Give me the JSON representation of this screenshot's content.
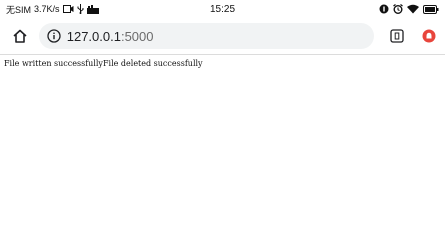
{
  "status_bar": {
    "carrier": "无SIM",
    "network_speed": "3.7K/s",
    "time": "15:25",
    "left_icons": [
      "video-icon",
      "usb-icon",
      "signal-bars-icon"
    ],
    "right_icons": [
      "notification-icon",
      "alarm-icon",
      "wifi-icon",
      "battery-icon"
    ]
  },
  "browser": {
    "url_host": "127.0.0.1",
    "url_port": ":5000",
    "icons": [
      "home-icon",
      "info-icon",
      "tab-switcher-icon",
      "extension-icon"
    ],
    "accent": "#e8453c"
  },
  "page": {
    "message_1": "File written successfully",
    "message_2": "File deleted successfully"
  }
}
